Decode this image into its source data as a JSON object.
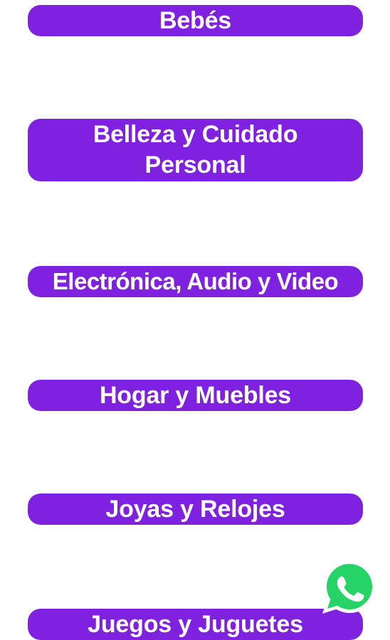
{
  "categories": [
    {
      "label": "Bebés"
    },
    {
      "label": "Belleza y Cuidado Personal"
    },
    {
      "label": "Electrónica, Audio y Video"
    },
    {
      "label": "Hogar y Muebles"
    },
    {
      "label": "Joyas y Relojes"
    },
    {
      "label": "Juegos y Juguetes"
    }
  ],
  "whatsapp": {
    "icon": "whatsapp-icon",
    "color": "#25d366"
  },
  "colors": {
    "button_bg": "#7e22e0",
    "button_text": "#ffffff",
    "page_bg": "#ffffff"
  }
}
